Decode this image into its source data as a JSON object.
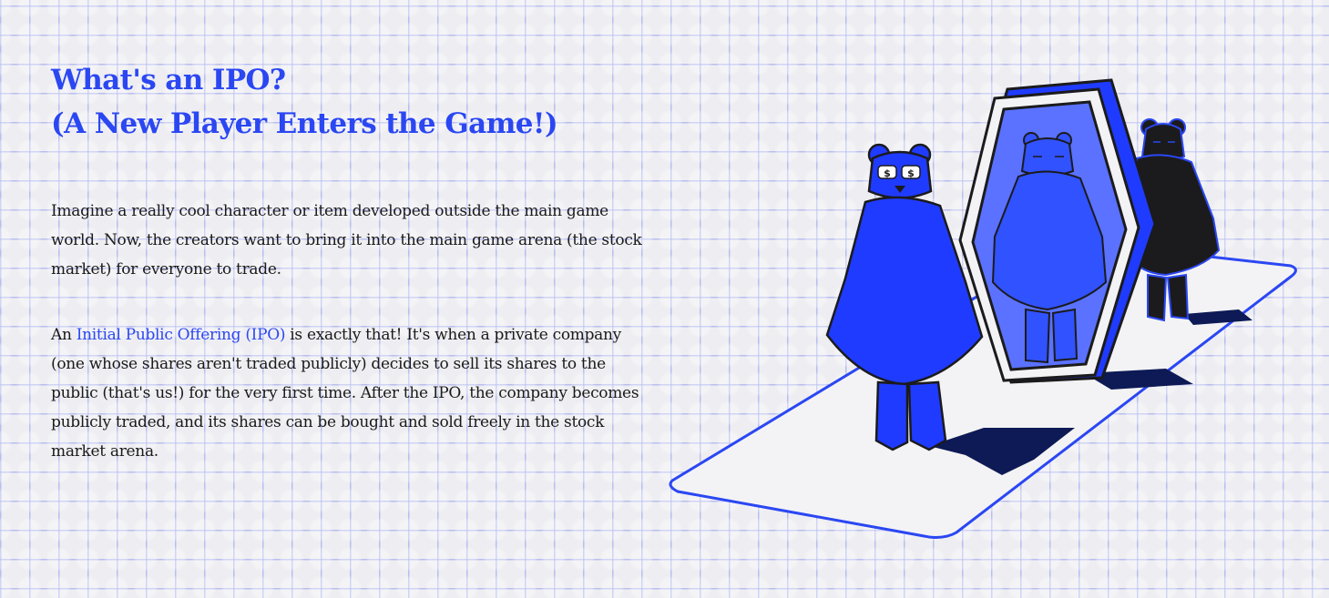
{
  "section": {
    "title_line1": "What's an IPO?",
    "title_line2": "(A New Player Enters the Game!)",
    "paragraph1": "Imagine a really cool character or item developed outside the main game world. Now, the creators want to bring it into the main game arena (the stock market) for everyone to trade.",
    "paragraph2": {
      "prefix": "An ",
      "link_text": "Initial Public Offering (IPO)",
      "suffix": " is exactly that! It's when a private company (one whose shares aren't traded publicly) decides to sell its shares to the public (that's us!) for the very first time. After the IPO, the company becomes publicly traded, and its shares can be bought and sold freely in the stock market arena."
    }
  },
  "illustration": {
    "description_icons": [
      "bear-with-dollar-glasses-icon",
      "mirror-portal-icon",
      "reflected-bear-icon",
      "dark-bear-icon"
    ],
    "glasses_symbol": "$"
  },
  "colors": {
    "accent_blue": "#2b47f2",
    "bear_blue": "#1f3bff",
    "dark_bear": "#1b1b1d",
    "background": "#eeeef2",
    "text": "#1a1a1a"
  }
}
